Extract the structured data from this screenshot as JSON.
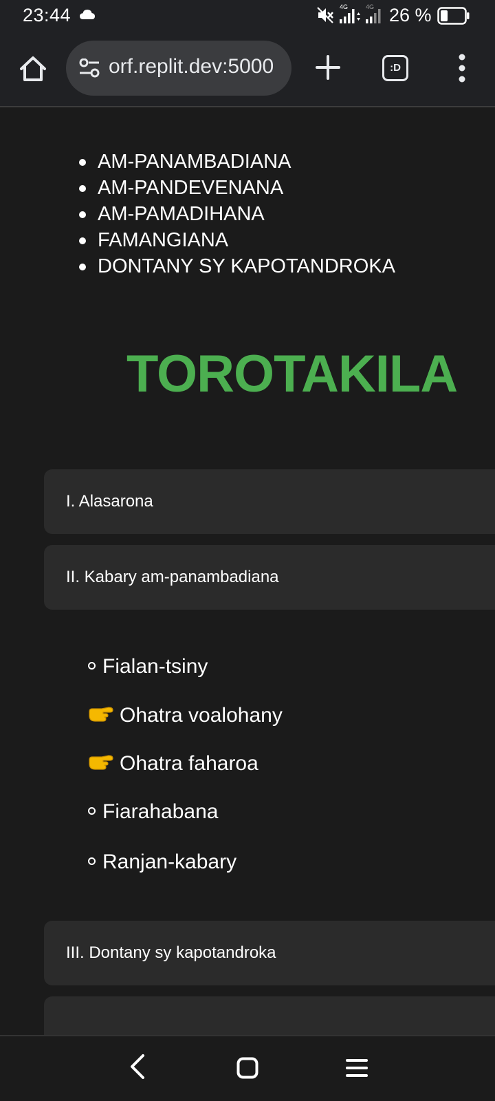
{
  "status": {
    "time": "23:44",
    "net_label_1": "4G",
    "net_label_2": "4G",
    "battery_text": "26 %"
  },
  "browser": {
    "url": "orf.replit.dev:5000",
    "tabs_label": ":D",
    "icons": [
      "home-icon",
      "site-settings-icon",
      "plus-icon",
      "tab-switcher-icon",
      "more-vert-icon"
    ]
  },
  "top_list": [
    "AM-PANAMBADIANA",
    "AM-PANDEVENANA",
    "AM-PAMADIHANA",
    "FAMANGIANA",
    "DONTANY SY KAPOTANDROKA"
  ],
  "title": "TOROTAKILA",
  "sections": [
    "I. Alasarona",
    "II. Kabary am-panambadiana",
    "III. Dontany sy kapotandroka"
  ],
  "sub_items": [
    {
      "marker": "circle",
      "text": "Fialan-tsiny"
    },
    {
      "marker": "pointing-hand",
      "text": "Ohatra voalohany"
    },
    {
      "marker": "pointing-hand",
      "text": "Ohatra faharoa"
    },
    {
      "marker": "circle",
      "text": "Fiarahabana"
    },
    {
      "marker": "circle",
      "text": "Ranjan-kabary"
    }
  ],
  "colors": {
    "title_green": "#4caf50",
    "background": "#1b1b1b",
    "card": "#2b2b2b"
  }
}
